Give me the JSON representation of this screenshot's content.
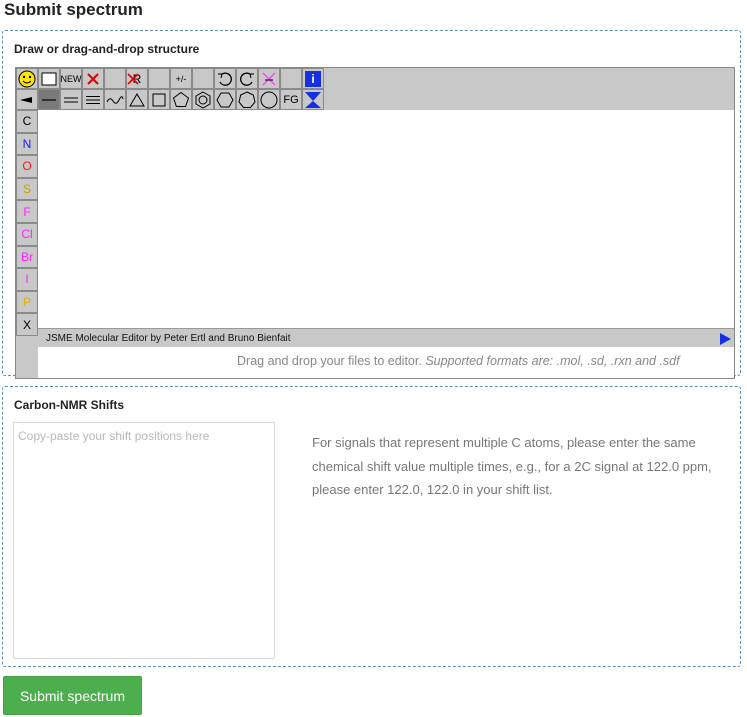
{
  "page_title": "Submit spectrum",
  "draw_panel": {
    "title": "Draw or drag-and-drop structure",
    "hint_plain": "Drag and drop your files to editor.",
    "hint_italic": "Supported formats are: .mol, .sd, .rxn and .sdf"
  },
  "editor": {
    "toolbar_row1": [
      {
        "name": "smiley-icon"
      },
      {
        "name": "clipboard-icon"
      },
      {
        "name": "new-button",
        "label": "NEW"
      },
      {
        "name": "delete-icon"
      },
      {
        "name": "blank-tool-1"
      },
      {
        "name": "delete-r-group-icon",
        "label": "R"
      },
      {
        "name": "blank-tool-2"
      },
      {
        "name": "charge-icon",
        "label": "+/-"
      },
      {
        "name": "blank-tool-3"
      },
      {
        "name": "undo-icon"
      },
      {
        "name": "redo-icon"
      },
      {
        "name": "reaction-icon"
      },
      {
        "name": "blank-tool-4"
      },
      {
        "name": "info-icon",
        "label": "i"
      }
    ],
    "toolbar_row2": [
      {
        "name": "wedge-bond-icon"
      },
      {
        "name": "single-bond-icon"
      },
      {
        "name": "double-bond-icon"
      },
      {
        "name": "triple-bond-icon"
      },
      {
        "name": "chain-icon"
      },
      {
        "name": "ring-3-icon"
      },
      {
        "name": "ring-4-icon"
      },
      {
        "name": "ring-5-icon"
      },
      {
        "name": "benzene-icon"
      },
      {
        "name": "ring-6-icon"
      },
      {
        "name": "ring-7-icon"
      },
      {
        "name": "ring-8-icon"
      },
      {
        "name": "fg-button",
        "label": "FG"
      },
      {
        "name": "jsme-logo-icon"
      }
    ],
    "atoms": [
      {
        "symbol": "C",
        "color": "#000000"
      },
      {
        "symbol": "N",
        "color": "#1a1aff"
      },
      {
        "symbol": "O",
        "color": "#ff1a1a"
      },
      {
        "symbol": "S",
        "color": "#c8a000"
      },
      {
        "symbol": "F",
        "color": "#ff22ff"
      },
      {
        "symbol": "Cl",
        "color": "#ff22ff"
      },
      {
        "symbol": "Br",
        "color": "#ff22ff"
      },
      {
        "symbol": "I",
        "color": "#ff22ff"
      },
      {
        "symbol": "P",
        "color": "#e8b000"
      },
      {
        "symbol": "X",
        "color": "#000000"
      }
    ],
    "status_text": "JSME Molecular Editor by Peter Ertl and Bruno Bienfait"
  },
  "nmr_panel": {
    "title": "Carbon-NMR Shifts",
    "input_placeholder": "Copy-paste your shift positions here",
    "input_value": "",
    "help_text": "For signals that represent multiple C atoms, please enter the same chemical shift value multiple times, e.g., for a 2C signal at 122.0 ppm, please enter 122.0, 122.0 in your shift list."
  },
  "submit_label": "Submit spectrum",
  "colors": {
    "accent_green": "#4cae4c",
    "panel_border": "#5c8fb8",
    "toolbar_gray": "#c8c8c8"
  }
}
